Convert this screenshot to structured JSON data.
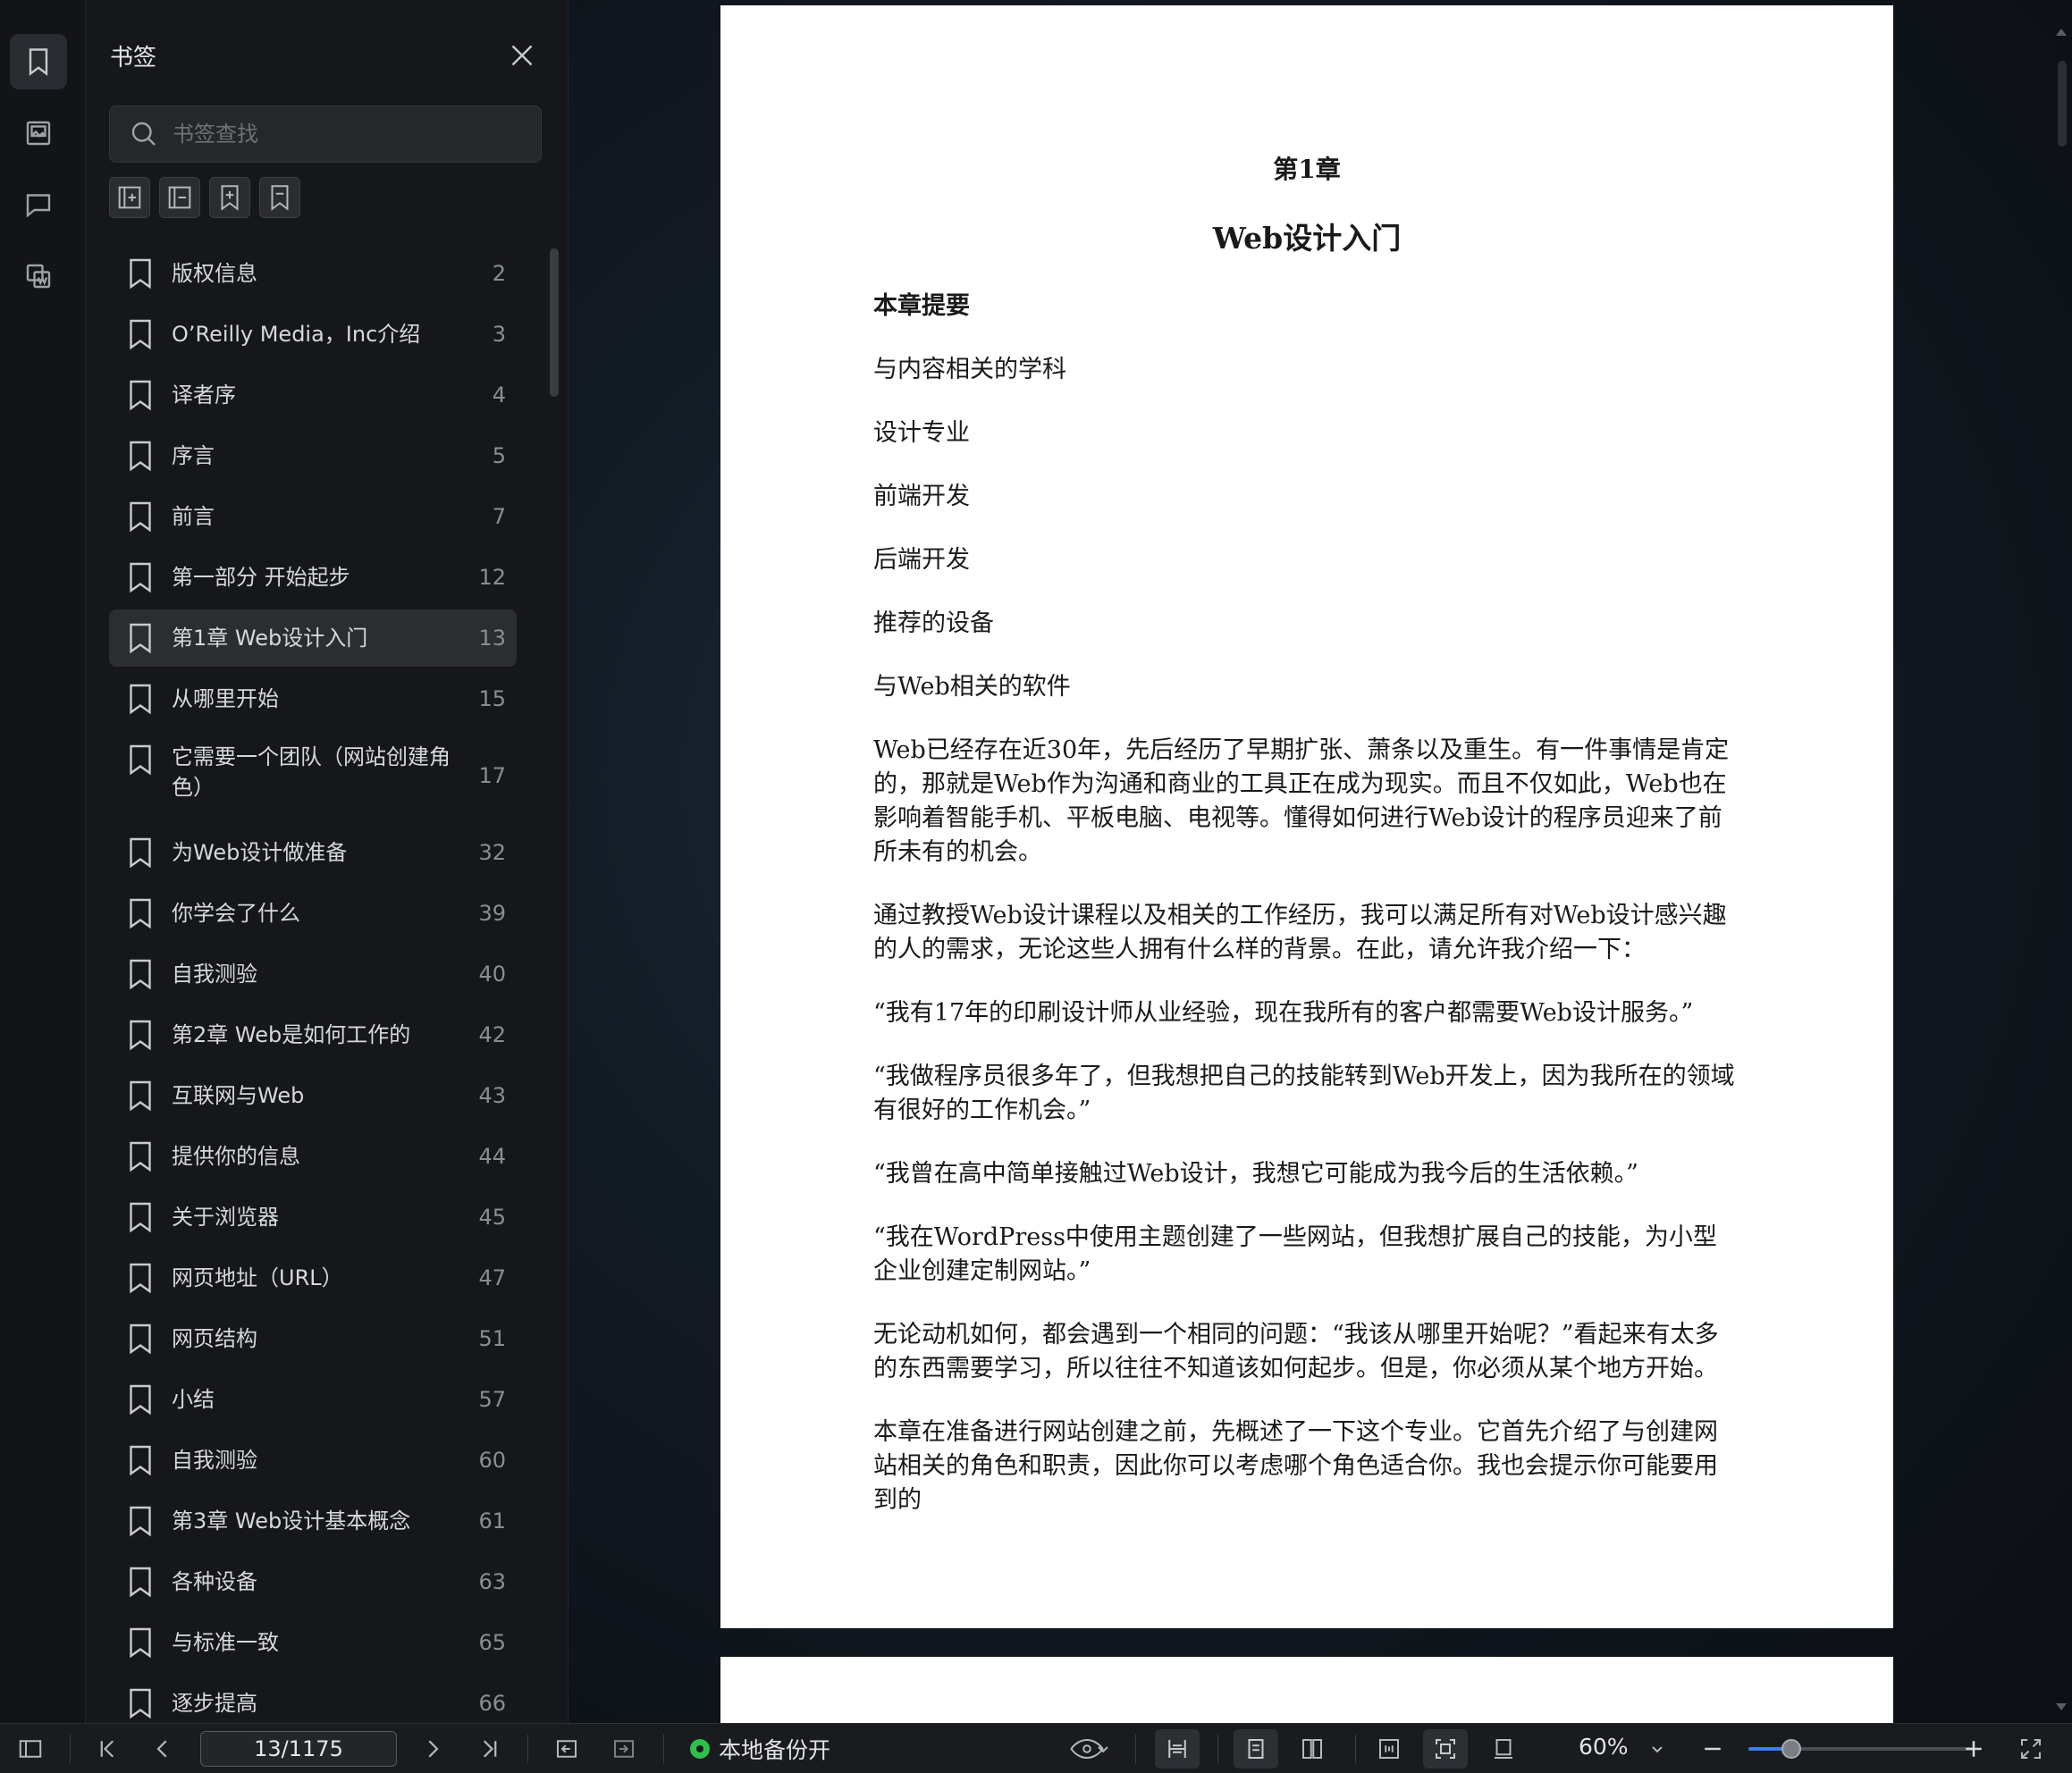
{
  "panel": {
    "title": "书签",
    "search_placeholder": "书签查找"
  },
  "bookmarks": [
    {
      "label": "版权信息",
      "page": "2"
    },
    {
      "label": "O’Reilly Media，Inc介绍",
      "page": "3"
    },
    {
      "label": "译者序",
      "page": "4"
    },
    {
      "label": "序言",
      "page": "5"
    },
    {
      "label": "前言",
      "page": "7"
    },
    {
      "label": "第一部分 开始起步",
      "page": "12"
    },
    {
      "label": "第1章 Web设计入门",
      "page": "13"
    },
    {
      "label": "从哪里开始",
      "page": "15"
    },
    {
      "label": "它需要一个团队（网站创建角色）",
      "page": "17"
    },
    {
      "label": "为Web设计做准备",
      "page": "32"
    },
    {
      "label": "你学会了什么",
      "page": "39"
    },
    {
      "label": "自我测验",
      "page": "40"
    },
    {
      "label": "第2章 Web是如何工作的",
      "page": "42"
    },
    {
      "label": "互联网与Web",
      "page": "43"
    },
    {
      "label": "提供你的信息",
      "page": "44"
    },
    {
      "label": "关于浏览器",
      "page": "45"
    },
    {
      "label": "网页地址（URL）",
      "page": "47"
    },
    {
      "label": "网页结构",
      "page": "51"
    },
    {
      "label": "小结",
      "page": "57"
    },
    {
      "label": "自我测验",
      "page": "60"
    },
    {
      "label": "第3章 Web设计基本概念",
      "page": "61"
    },
    {
      "label": "各种设备",
      "page": "63"
    },
    {
      "label": "与标准一致",
      "page": "65"
    },
    {
      "label": "逐步提高",
      "page": "66"
    }
  ],
  "document": {
    "chapter_number": "第1章",
    "chapter_title": "Web设计入门",
    "paragraphs": [
      "本章提要",
      "与内容相关的学科",
      "设计专业",
      "前端开发",
      "后端开发",
      "推荐的设备",
      "与Web相关的软件",
      "Web已经存在近30年，先后经历了早期扩张、萧条以及重生。有一件事情是肯定的，那就是Web作为沟通和商业的工具正在成为现实。而且不仅如此，Web也在影响着智能手机、平板电脑、电视等。懂得如何进行Web设计的程序员迎来了前所未有的机会。",
      "通过教授Web设计课程以及相关的工作经历，我可以满足所有对Web设计感兴趣的人的需求，无论这些人拥有什么样的背景。在此，请允许我介绍一下：",
      "“我有17年的印刷设计师从业经验，现在我所有的客户都需要Web设计服务。”",
      "“我做程序员很多年了，但我想把自己的技能转到Web开发上，因为我所在的领域有很好的工作机会。”",
      "“我曾在高中简单接触过Web设计，我想它可能成为我今后的生活依赖。”",
      "“我在WordPress中使用主题创建了一些网站，但我想扩展自己的技能，为小型企业创建定制网站。”",
      "无论动机如何，都会遇到一个相同的问题：“我该从哪里开始呢？”看起来有太多的东西需要学习，所以往往不知道该如何起步。但是，你必须从某个地方开始。",
      "本章在准备进行网站创建之前，先概述了一下这个专业。它首先介绍了与创建网站相关的角色和职责，因此你可以考虑哪个角色适合你。我也会提示你可能要用到的"
    ]
  },
  "statusbar": {
    "page_indicator": "13/1175",
    "backup_label": "本地备份开",
    "zoom": "60%",
    "zoom_slider_fraction": 0.19
  },
  "colors": {
    "accent": "#3b7fe5",
    "backup_dot": "#2fbf4a",
    "selected_row": "#2b2d31"
  }
}
